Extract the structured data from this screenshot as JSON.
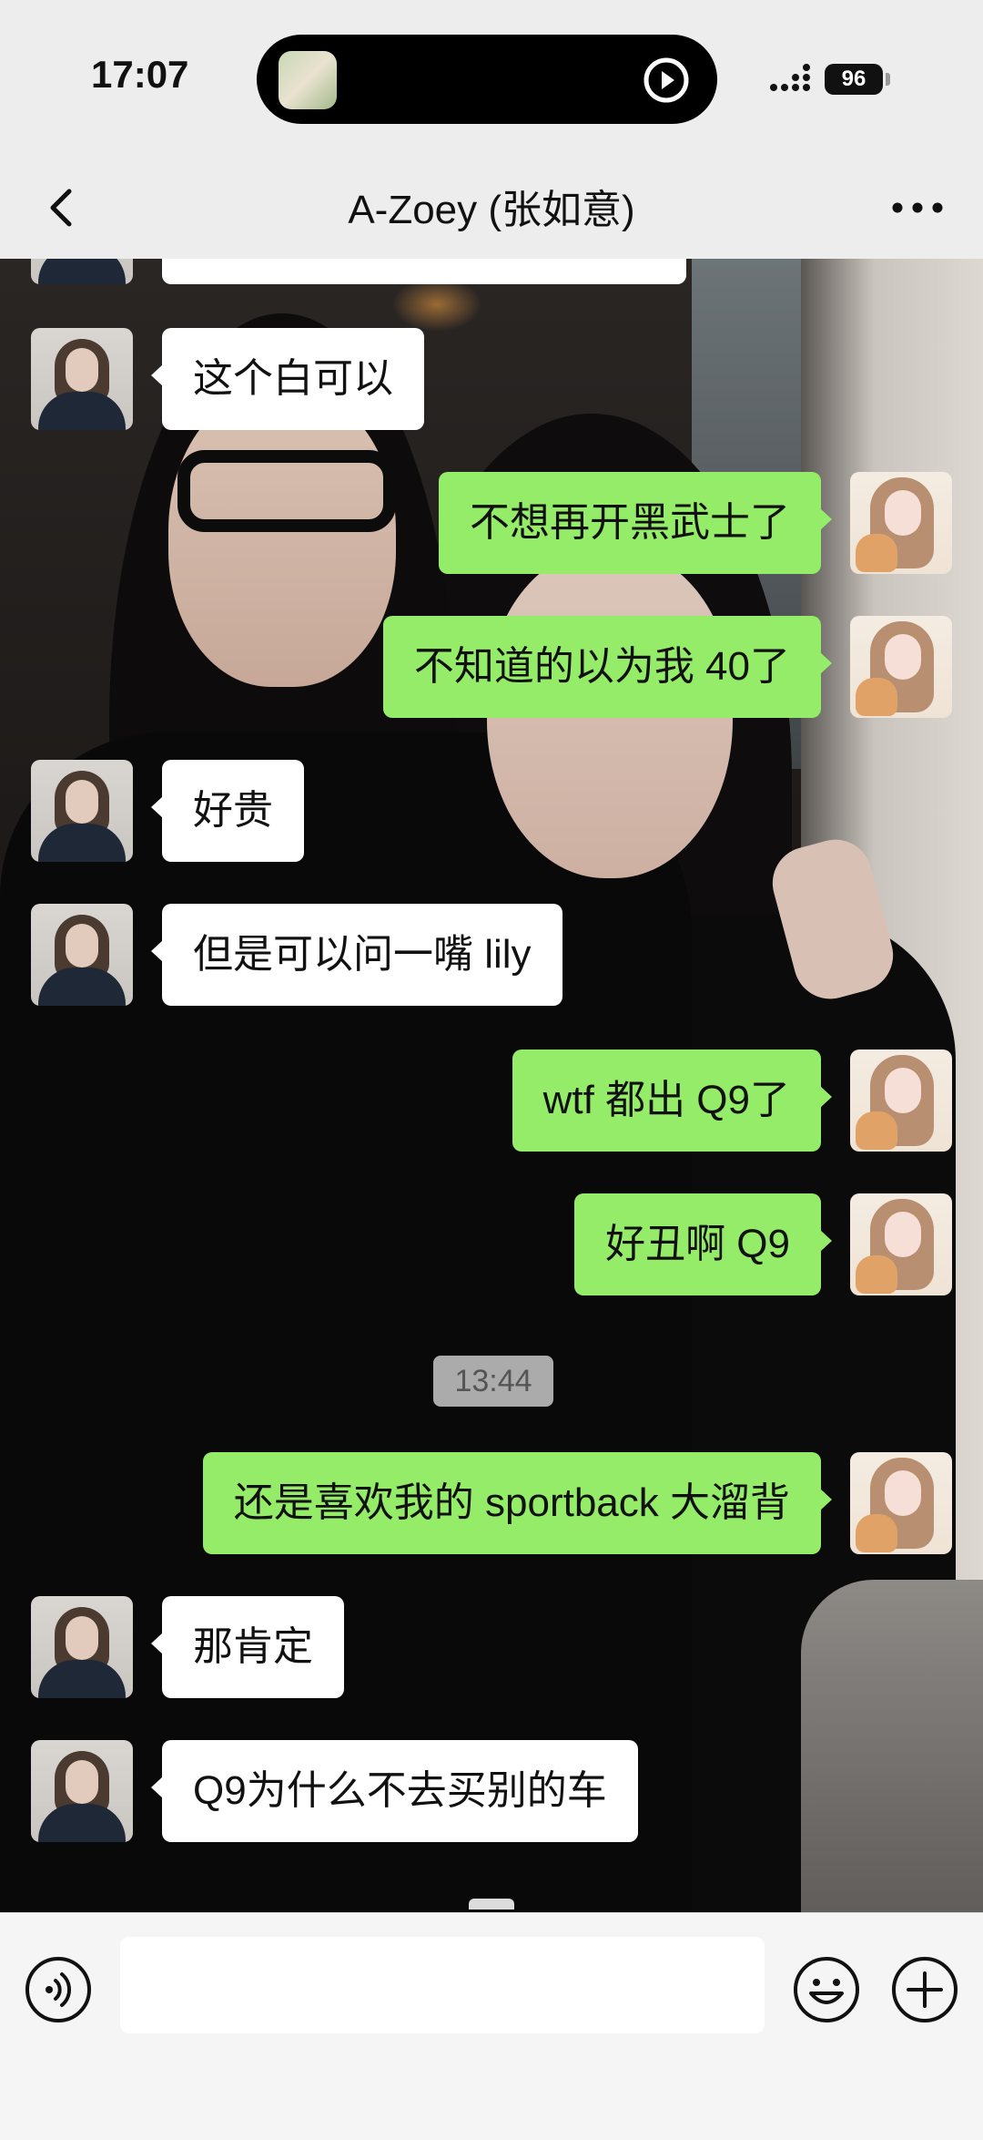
{
  "status_bar": {
    "time": "17:07",
    "battery": "96"
  },
  "header": {
    "title": "A-Zoey (张如意)"
  },
  "messages": [
    {
      "from": "friend",
      "text": ""
    },
    {
      "from": "friend",
      "text": "这个白可以"
    },
    {
      "from": "me",
      "text": "不想再开黑武士了"
    },
    {
      "from": "me",
      "text": "不知道的以为我 40了"
    },
    {
      "from": "friend",
      "text": "好贵"
    },
    {
      "from": "friend",
      "text": "但是可以问一嘴 lily"
    },
    {
      "from": "me",
      "text": "wtf 都出 Q9了"
    },
    {
      "from": "me",
      "text": "好丑啊 Q9"
    },
    {
      "from": "me",
      "text": "还是喜欢我的 sportback 大溜背"
    },
    {
      "from": "friend",
      "text": "那肯定"
    },
    {
      "from": "friend",
      "text": "Q9为什么不去买别的车"
    }
  ],
  "timestamp": "13:44",
  "input": {
    "value": "",
    "placeholder": ""
  },
  "colors": {
    "bar_background": "#ededed",
    "outgoing_bubble": "#95ec69",
    "incoming_bubble": "#ffffff"
  },
  "icons": [
    "back-icon",
    "more-icon",
    "voice-icon",
    "emoji-icon",
    "plus-icon",
    "play-icon"
  ]
}
